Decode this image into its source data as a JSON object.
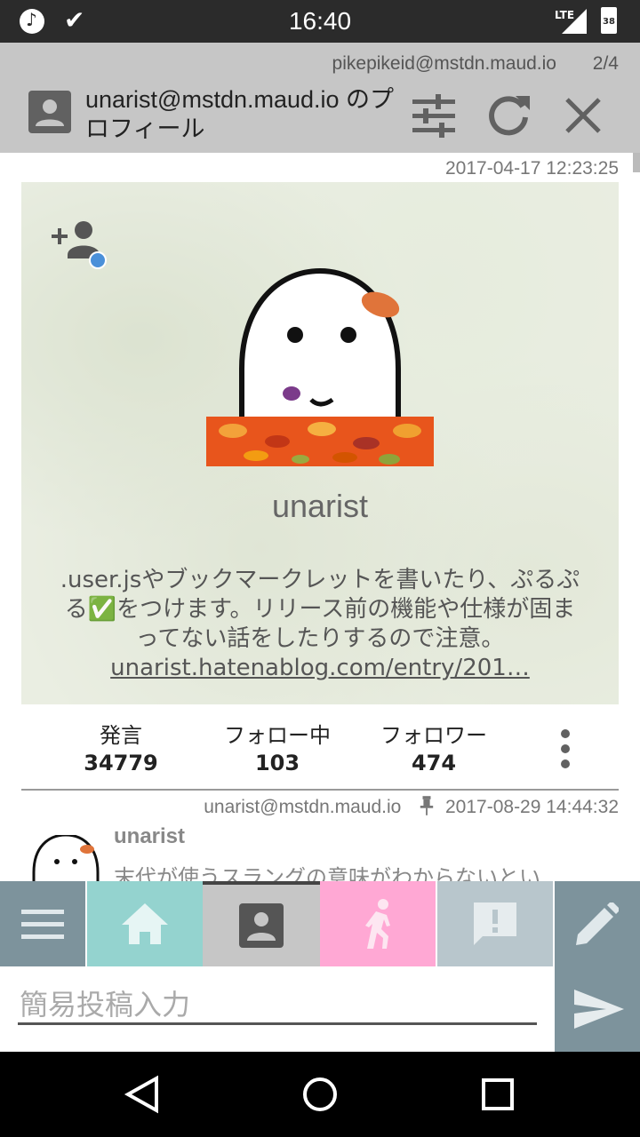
{
  "status_bar": {
    "time": "16:40",
    "network": "LTE",
    "battery": "38",
    "icons": [
      "music-icon",
      "check-icon",
      "signal-icon",
      "battery-icon"
    ]
  },
  "header": {
    "account": "pikepikeid@mstdn.maud.io",
    "page_indicator": "2/4",
    "title": "unarist@mstdn.maud.io のプロフィール"
  },
  "profile": {
    "date": "2017-04-17 12:23:25",
    "display_name": "unarist",
    "bio_text": ".user.jsやブックマークレットを書いたり、ぷるぷる✅をつけます。リリース前の機能や仕様が固まってない話をしたりするので注意。",
    "bio_link": "unarist.hatenablog.com/entry/201…",
    "stats": [
      {
        "label": "発言",
        "value": "34779"
      },
      {
        "label": "フォロー中",
        "value": "103"
      },
      {
        "label": "フォロワー",
        "value": "474"
      }
    ]
  },
  "pinned_post": {
    "account": "unarist@mstdn.maud.io",
    "date": "2017-08-29 14:44:32",
    "name": "unarist",
    "text": "末代が使うスラングの意味がわからないとい"
  },
  "tabs": [
    {
      "name": "menu",
      "color": "#7d939c"
    },
    {
      "name": "home",
      "color": "#94d3cf"
    },
    {
      "name": "profile",
      "color": "#c6c6c6"
    },
    {
      "name": "activity",
      "color": "#ffa8d4"
    },
    {
      "name": "notifications",
      "color": "#b8c6cc"
    },
    {
      "name": "compose",
      "color": "#7d939c"
    }
  ],
  "quick_post": {
    "placeholder": "簡易投稿入力"
  }
}
